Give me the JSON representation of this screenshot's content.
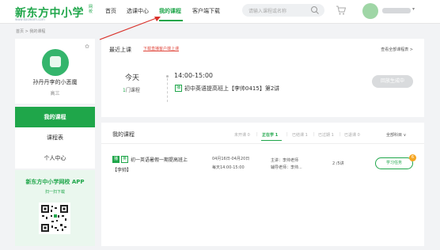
{
  "header": {
    "logo_main": "新东方中小学",
    "logo_small": "网校",
    "logo_url": "www.koolearn.com",
    "nav": [
      {
        "label": "首页"
      },
      {
        "label": "选课中心"
      },
      {
        "label": "我的课程"
      },
      {
        "label": "客户端下载"
      }
    ],
    "active_nav": "我的课程",
    "search_placeholder": "请输入课程或名称"
  },
  "breadcrumb": "首页 > 我的课程",
  "profile": {
    "name": "孙丹丹李的小恶魔",
    "grade": "高三"
  },
  "side_menu": [
    {
      "label": "我的课程"
    },
    {
      "label": "课程表"
    },
    {
      "label": "个人中心"
    }
  ],
  "app_promo": {
    "title": "新东方中小学网校 APP",
    "subtitle": "扫一扫下载"
  },
  "recent": {
    "title": "最近上课",
    "link": "下载直播客户端上课",
    "all_link": "查看全部课程表 >",
    "day": "今天",
    "count_num": "1",
    "count_suffix": "门课程",
    "time": "14:00-15:00",
    "tag": "播",
    "course": "初中英语提高班上【李帅0415】第2讲",
    "enter_button": "回放生成中"
  },
  "my_courses": {
    "title": "我的课程",
    "tabs": [
      {
        "label": "未开课 0"
      },
      {
        "label": "正在学 1"
      },
      {
        "label": "已结课 1"
      },
      {
        "label": "已过期 1"
      },
      {
        "label": "已退课 0"
      }
    ],
    "subject_filter": "全部科目 ∨",
    "row": {
      "tag1": "播",
      "tag2": "英",
      "title_line1": "初一英语暑假一期提高班上",
      "title_line2": "【李帅】",
      "date": "04月16日-04月20日",
      "schedule": "每天14:00-15:00",
      "main_teacher": "主讲：李帅老师",
      "tutor": "辅导老师：李帅...",
      "progress": "2 /5讲",
      "task_button": "学习任务",
      "task_badge": "6"
    }
  },
  "colors": {
    "brand": "#1fa64a",
    "arrow": "#d9322b"
  }
}
